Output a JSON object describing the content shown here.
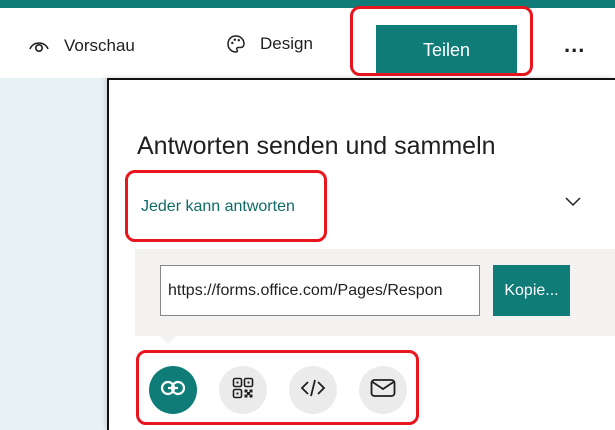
{
  "toolbar": {
    "preview_label": "Vorschau",
    "design_label": "Design",
    "share_label": "Teilen",
    "more_label": "..."
  },
  "panel": {
    "title": "Antworten senden und sammeln",
    "permission_label": "Jeder kann antworten",
    "link_url": "https://forms.office.com/Pages/Respon",
    "copy_label": "Kopie..."
  },
  "share_options": [
    {
      "icon": "link-icon",
      "selected": true
    },
    {
      "icon": "qr-code-icon",
      "selected": false
    },
    {
      "icon": "embed-code-icon",
      "selected": false
    },
    {
      "icon": "email-icon",
      "selected": false
    }
  ],
  "colors": {
    "accent": "#0f7c78",
    "highlight": "#e8141e",
    "link_text": "#106a66",
    "side_background": "#e8f1f4",
    "link_box_background": "#f3f2f1"
  }
}
